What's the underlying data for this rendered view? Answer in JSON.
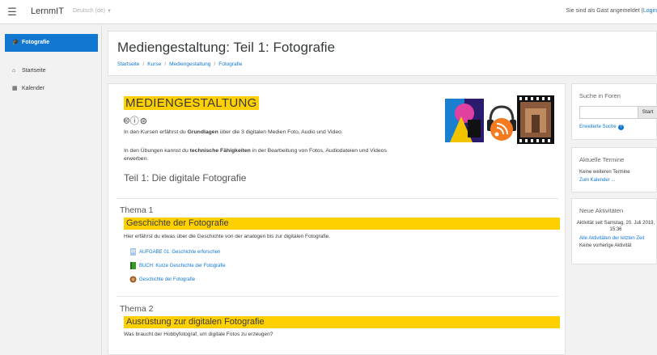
{
  "navbar": {
    "brand": "LernmIT",
    "language": "Deutsch (de)",
    "login_text": "Sie sind als Gast angemeldet (",
    "login_link": "Login"
  },
  "drawer": {
    "active_item": "Fotografie",
    "items": [
      "Startseite",
      "Kalender"
    ]
  },
  "header": {
    "title": "Mediengestaltung: Teil 1: Fotografie",
    "breadcrumb": [
      "Startseite",
      "Kurse",
      "Mediengestaltung",
      "Fotografie"
    ]
  },
  "summary": {
    "heading": "MEDIENGESTALTUNG",
    "cc_symbols": "🅭ⓘ⊜",
    "intro1_before": "In den Kursen erfährst du ",
    "intro1_bold": "Grundlagen",
    "intro1_after": " über die 3 digitalen Medien Foto, Audio und Video.",
    "intro2_before": "In den Übungen kannst du ",
    "intro2_bold": "technische Fähigkeiten",
    "intro2_after": " in der Bearbeitung von Fotos, Audiodateien und Videos erwerben.",
    "part_title": "Teil 1: Die digitale Fotografie"
  },
  "topics": [
    {
      "label": "Thema 1",
      "title": "Geschichte der Fotografie",
      "description": "Hier erfährst du etwas über die Geschichte von der analogen bis zur digitalen Fotografie.",
      "activities": [
        {
          "label": "AUFGABE 01: Geschichte erforschen",
          "icon": "assignment-icon"
        },
        {
          "label": "BUCH: Kurze Geschichte der Fotografie",
          "icon": "book-icon"
        },
        {
          "label": "Geschichte der Fotografie",
          "icon": "page-icon"
        }
      ]
    },
    {
      "label": "Thema 2",
      "title": "Ausrüstung zur digitalen Fotografie",
      "description": "Was braucht der Hobbyfotograf, um digitale Fotos zu erzeugen?",
      "activities": []
    }
  ],
  "blocks": {
    "search": {
      "title": "Suche in Foren",
      "button": "Start",
      "advanced": "Erweiterte Suche",
      "input_value": ""
    },
    "events": {
      "title": "Aktuelle Termine",
      "none": "Keine weiteren Termine",
      "link": "Zum Kalender ..."
    },
    "activity": {
      "title": "Neue Aktivitäten",
      "since": "Aktivität seit Samstag, 20. Juli 2019, 15:36",
      "link": "Alle Aktivitäten der letzten Zeit",
      "none": "Keine vorherige Aktivität"
    }
  },
  "colors": {
    "accent": "#1177d1",
    "highlight": "#ffd000"
  }
}
